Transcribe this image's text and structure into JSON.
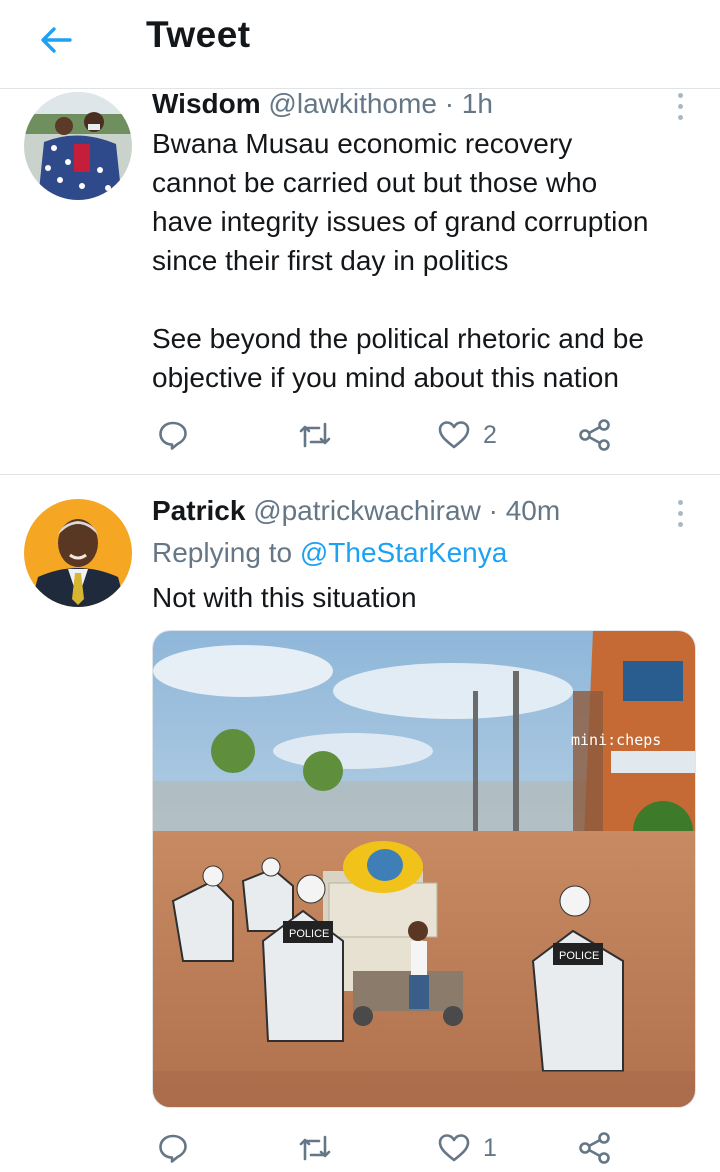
{
  "header": {
    "title": "Tweet"
  },
  "tweets": [
    {
      "name": "Wisdom",
      "handle": "@lawkithome",
      "separator": "·",
      "time": "1h",
      "lines": [
        "Bwana Musau economic recovery",
        "cannot be carried out but those who",
        "have integrity issues of grand corruption",
        "since their first day in politics",
        "",
        "See beyond the political rhetoric and be",
        "objective if you mind about this nation"
      ],
      "likes": "2"
    },
    {
      "name": "Patrick",
      "handle": "@patrickwachiraw",
      "separator": "·",
      "time": "40m",
      "replying_prefix": "Replying to",
      "replying_to": "@TheStarKenya",
      "text": "Not with this situation",
      "media_watermark": "mini:cheps",
      "media_signs": {
        "police": "POLICE"
      },
      "likes": "1"
    }
  ],
  "icons": [
    "back-arrow-icon",
    "more-icon",
    "reply-icon",
    "retweet-icon",
    "like-icon",
    "share-icon"
  ],
  "colors": {
    "accent": "#1da1f2",
    "secondary_text": "#657786",
    "divider": "#e1e4e6",
    "text": "#14171a"
  }
}
